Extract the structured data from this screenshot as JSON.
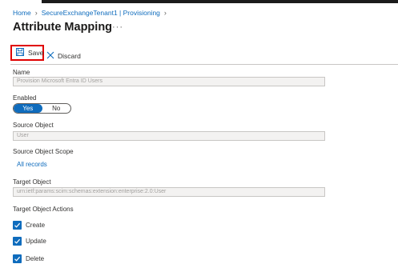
{
  "breadcrumb": {
    "items": [
      "Home",
      "SecureExchangeTenant1 | Provisioning"
    ]
  },
  "page": {
    "title": "Attribute Mapping",
    "more": "···"
  },
  "toolbar": {
    "save_label": "Save",
    "discard_label": "Discard"
  },
  "form": {
    "name_label": "Name",
    "name_value": "Provision Microsoft Entra ID Users",
    "enabled_label": "Enabled",
    "enabled_yes": "Yes",
    "enabled_no": "No",
    "enabled_value": "Yes",
    "source_object_label": "Source Object",
    "source_object_value": "User",
    "source_scope_label": "Source Object Scope",
    "source_scope_link": "All records",
    "target_object_label": "Target Object",
    "target_object_value": "urn:ietf:params:scim:schemas:extension:enterprise:2.0:User",
    "target_actions_label": "Target Object Actions",
    "actions": [
      {
        "label": "Create",
        "checked": true
      },
      {
        "label": "Update",
        "checked": true
      },
      {
        "label": "Delete",
        "checked": true
      }
    ]
  },
  "colors": {
    "accent": "#0f6cbd",
    "highlight": "#e00000"
  },
  "icons": {
    "save": "save-icon",
    "discard": "close-icon",
    "checkbox": "checkmark-icon"
  }
}
